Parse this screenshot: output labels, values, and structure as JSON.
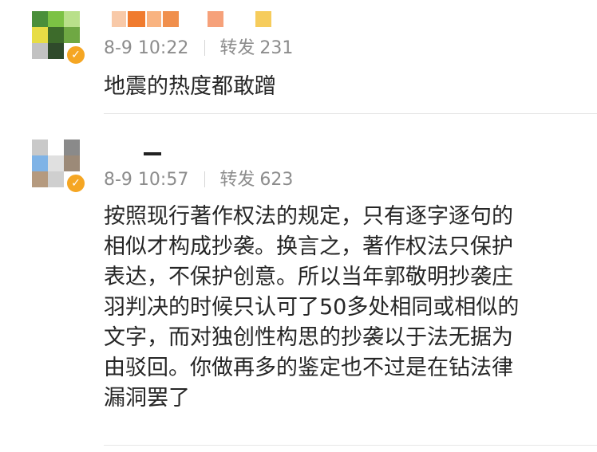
{
  "comments": [
    {
      "timestamp": "8-9 10:22",
      "repost_label": "转发",
      "repost_count": "231",
      "text": "地震的热度都敢蹭",
      "verified_icon": "v-badge-icon"
    },
    {
      "timestamp": "8-9 10:57",
      "repost_label": "转发",
      "repost_count": "623",
      "text": "按照现行著作权法的规定，只有逐字逐句的\n相似才构成抄袭。换言之，著作权法只保护\n表达，不保护创意。所以当年郭敬明抄袭庄\n羽判决的时候只认可了50多处相同或相似的\n文字，而对独创性构思的抄袭以于法无据为\n由驳回。你做再多的鉴定也不过是在钻法律\n漏洞罢了",
      "verified_icon": "v-badge-icon"
    }
  ],
  "colors": {
    "meta_gray": "#8c8c8c",
    "verified_orange": "#f5a623",
    "divider": "#e6e6e6"
  }
}
